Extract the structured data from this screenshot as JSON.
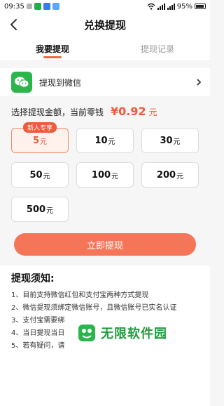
{
  "status_bar": {
    "time": "09:35",
    "battery": "95%"
  },
  "header": {
    "title": "兑换提现"
  },
  "tabs": [
    {
      "label": "我要提现",
      "active": true
    },
    {
      "label": "提现记录",
      "active": false
    }
  ],
  "withdraw_to": {
    "label": "提现到微信"
  },
  "amount": {
    "prompt": "选择提现金额，当前零钱",
    "value": "¥0.92",
    "unit": "元"
  },
  "options": [
    {
      "amount": "5",
      "unit": "元",
      "selected": true,
      "tag": "新人专享"
    },
    {
      "amount": "10",
      "unit": "元",
      "selected": false
    },
    {
      "amount": "30",
      "unit": "元",
      "selected": false
    },
    {
      "amount": "50",
      "unit": "元",
      "selected": false
    },
    {
      "amount": "100",
      "unit": "元",
      "selected": false
    },
    {
      "amount": "200",
      "unit": "元",
      "selected": false
    },
    {
      "amount": "500",
      "unit": "元",
      "selected": false
    }
  ],
  "submit_label": "立即提现",
  "notes": {
    "title": "提现须知:",
    "items": [
      "1、目前支持微信红包和支付宝两种方式提现",
      "2、微信提现须绑定微信账号，且微信账号已实名认证",
      "3、支付宝需要绑",
      "4、当日提现当日",
      "5、若有疑问，请"
    ]
  },
  "watermark": {
    "text": "无限软件园"
  },
  "colors": {
    "accent": "#f05a3a",
    "button": "#f47558",
    "wechat_green": "#2bb64c",
    "selected_bg": "#fff1ec"
  }
}
